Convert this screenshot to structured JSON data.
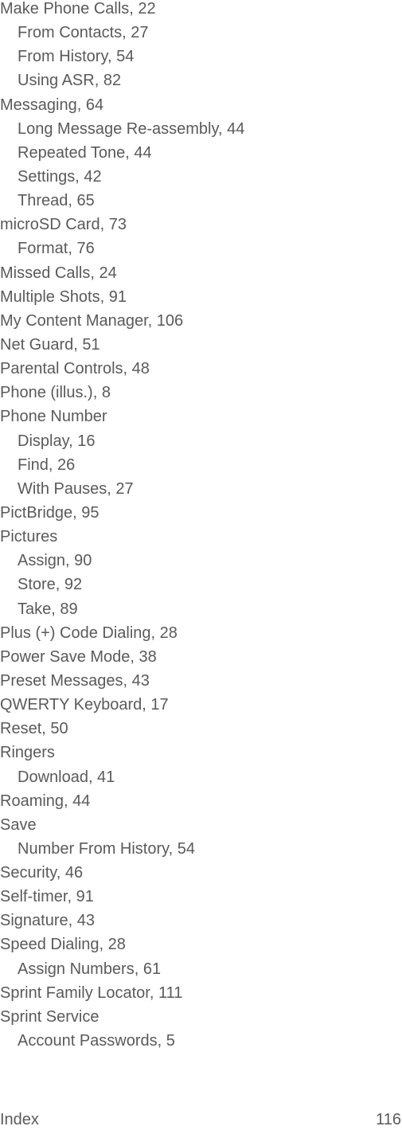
{
  "index_entries": [
    {
      "text": "Make Phone Calls, 22",
      "level": 0
    },
    {
      "text": "From Contacts, 27",
      "level": 1
    },
    {
      "text": "From History, 54",
      "level": 1
    },
    {
      "text": "Using ASR, 82",
      "level": 1
    },
    {
      "text": "Messaging, 64",
      "level": 0
    },
    {
      "text": "Long Message Re-assembly, 44",
      "level": 1
    },
    {
      "text": "Repeated Tone, 44",
      "level": 1
    },
    {
      "text": "Settings, 42",
      "level": 1
    },
    {
      "text": "Thread, 65",
      "level": 1
    },
    {
      "text": "microSD Card, 73",
      "level": 0
    },
    {
      "text": "Format, 76",
      "level": 1
    },
    {
      "text": "Missed Calls, 24",
      "level": 0
    },
    {
      "text": "Multiple Shots, 91",
      "level": 0
    },
    {
      "text": "My Content Manager, 106",
      "level": 0
    },
    {
      "text": "Net Guard, 51",
      "level": 0
    },
    {
      "text": "Parental Controls, 48",
      "level": 0
    },
    {
      "text": "Phone (illus.), 8",
      "level": 0
    },
    {
      "text": "Phone Number",
      "level": 0
    },
    {
      "text": "Display, 16",
      "level": 1
    },
    {
      "text": "Find, 26",
      "level": 1
    },
    {
      "text": "With Pauses, 27",
      "level": 1
    },
    {
      "text": "PictBridge, 95",
      "level": 0
    },
    {
      "text": "Pictures",
      "level": 0
    },
    {
      "text": "Assign, 90",
      "level": 1
    },
    {
      "text": "Store, 92",
      "level": 1
    },
    {
      "text": "Take, 89",
      "level": 1
    },
    {
      "text": "Plus (+) Code Dialing, 28",
      "level": 0
    },
    {
      "text": "Power Save Mode, 38",
      "level": 0
    },
    {
      "text": "Preset Messages, 43",
      "level": 0
    },
    {
      "text": "QWERTY Keyboard, 17",
      "level": 0
    },
    {
      "text": "Reset, 50",
      "level": 0
    },
    {
      "text": "Ringers",
      "level": 0
    },
    {
      "text": "Download, 41",
      "level": 1
    },
    {
      "text": "Roaming, 44",
      "level": 0
    },
    {
      "text": "Save",
      "level": 0
    },
    {
      "text": "Number From History, 54",
      "level": 1
    },
    {
      "text": "Security, 46",
      "level": 0
    },
    {
      "text": "Self-timer, 91",
      "level": 0
    },
    {
      "text": "Signature, 43",
      "level": 0
    },
    {
      "text": "Speed Dialing, 28",
      "level": 0
    },
    {
      "text": "Assign Numbers, 61",
      "level": 1
    },
    {
      "text": "Sprint Family Locator, 111",
      "level": 0
    },
    {
      "text": "Sprint Service",
      "level": 0
    },
    {
      "text": "Account Passwords, 5",
      "level": 1
    }
  ],
  "footer": {
    "section": "Index",
    "page_number": "116"
  }
}
